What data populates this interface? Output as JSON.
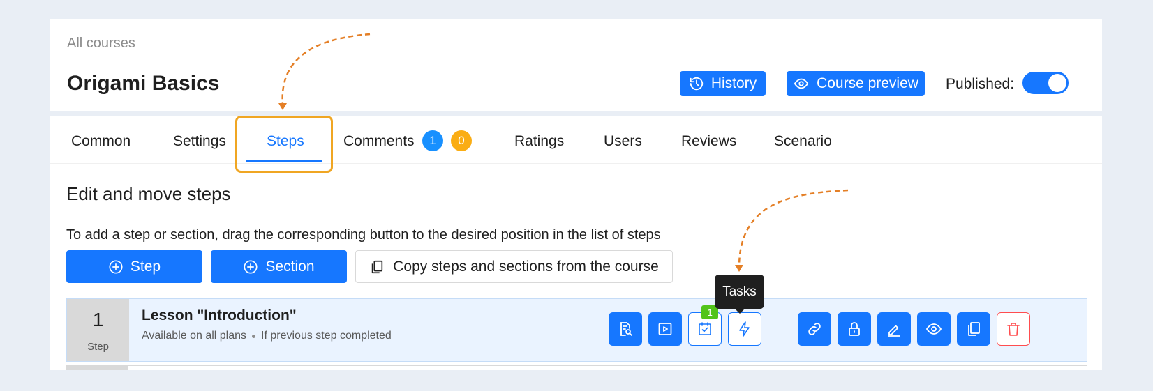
{
  "header": {
    "breadcrumb": "All courses",
    "title": "Origami Basics",
    "history_label": "History",
    "preview_label": "Course preview",
    "published_label": "Published",
    "published_colon": ":",
    "published_on": true
  },
  "tabs": [
    {
      "label": "Common"
    },
    {
      "label": "Settings"
    },
    {
      "label": "Steps",
      "active": true
    },
    {
      "label": "Comments",
      "badges": [
        "1",
        "0"
      ]
    },
    {
      "label": "Ratings"
    },
    {
      "label": "Users"
    },
    {
      "label": "Reviews"
    },
    {
      "label": "Scenario"
    }
  ],
  "steps_page": {
    "section_title": "Edit and move steps",
    "hint": "To add a step or section, drag the corresponding button to the desired position in the list of steps",
    "add_step_label": "Step",
    "add_section_label": "Section",
    "copy_label": "Copy steps and sections from the course"
  },
  "step_row": {
    "number": "1",
    "type_word": "Step",
    "title": "Lesson \"Introduction\"",
    "meta": [
      "Available on all plans",
      "If previous step completed"
    ],
    "video_count": "1",
    "tooltip": "Tasks"
  },
  "colors": {
    "primary": "#1677ff",
    "danger": "#ff4d4f",
    "badge_blue": "#1890ff",
    "badge_orange": "#faad14",
    "count_green": "#52c41a",
    "annotation_orange": "#e47f26",
    "highlight_border": "#f0a623"
  },
  "icons": {
    "history": "clock-history-icon",
    "preview": "eye-icon",
    "add": "plus-circle-icon",
    "copy": "copy-icon",
    "step_actions": [
      "document-search-icon",
      "play-video-icon",
      "tasks-calendar-check-icon",
      "lightning-icon",
      "link-icon",
      "lock-icon",
      "edit-pencil-icon",
      "eye-icon",
      "copy-icon",
      "trash-icon"
    ]
  }
}
